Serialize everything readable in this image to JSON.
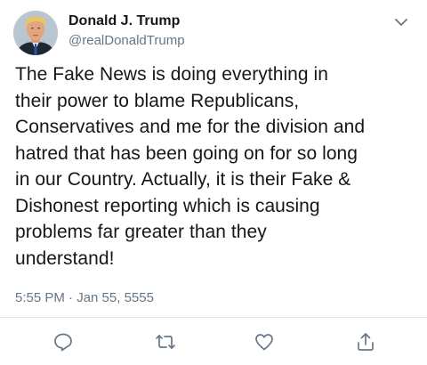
{
  "tweet": {
    "display_name": "Donald J. Trump",
    "handle": "@realDonaldTrump",
    "text": "The Fake News is doing everything in\ntheir power to blame Republicans,\nConservatives and me for the division and\nhatred that has been going on for so long\nin our Country. Actually, it is their Fake &\nDishonest reporting which is causing\nproblems far greater than they\nunderstand!",
    "timestamp": "5:55 PM · Jan 55, 5555"
  },
  "icons": {
    "menu": "chevron-down-icon",
    "reply": "reply-icon",
    "retweet": "retweet-icon",
    "like": "heart-icon",
    "share": "share-icon"
  },
  "colors": {
    "text": "#14171a",
    "secondary": "#657786",
    "icon": "#657786",
    "divider": "#e1e8ed"
  }
}
